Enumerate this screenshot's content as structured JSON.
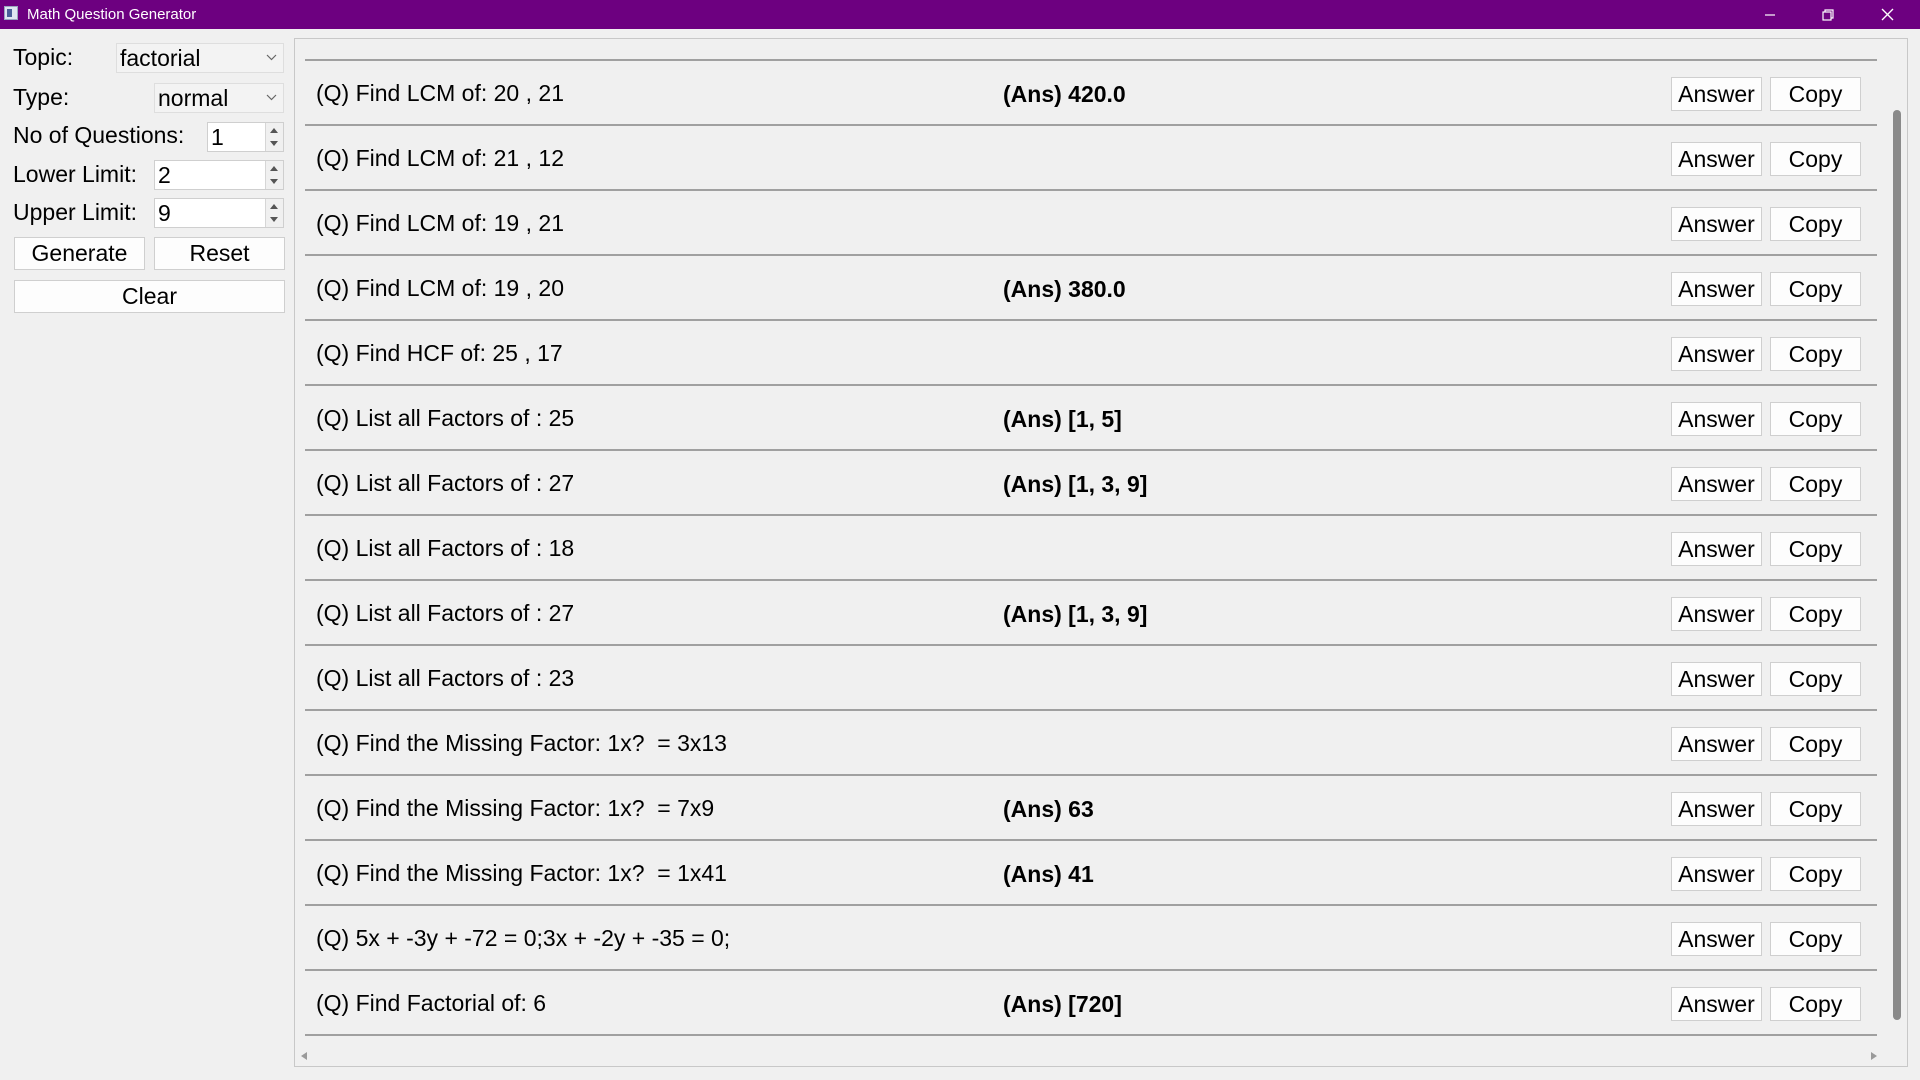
{
  "window": {
    "title": "Math Question Generator",
    "accent_color": "#6d0080",
    "controls": [
      "minimize-icon",
      "restore-icon",
      "close-icon"
    ]
  },
  "panel": {
    "topic_label": "Topic:",
    "topic_value": "factorial",
    "type_label": "Type:",
    "type_value": "normal",
    "count_label": "No of Questions:",
    "count_value": "1",
    "lower_label": "Lower Limit:",
    "lower_value": "2",
    "upper_label": "Upper Limit:",
    "upper_value": "9",
    "generate_label": "Generate",
    "reset_label": "Reset",
    "clear_label": "Clear"
  },
  "questions": [
    {
      "q": "(Q) Find LCM of: 20 , 21",
      "a": "(Ans) 420.0",
      "answer_label": "Answer",
      "copy_label": "Copy"
    },
    {
      "q": "(Q) Find LCM of: 21 , 12",
      "a": "",
      "answer_label": "Answer",
      "copy_label": "Copy"
    },
    {
      "q": "(Q) Find LCM of: 19 , 21",
      "a": "",
      "answer_label": "Answer",
      "copy_label": "Copy"
    },
    {
      "q": "(Q) Find LCM of: 19 , 20",
      "a": "(Ans) 380.0",
      "answer_label": "Answer",
      "copy_label": "Copy"
    },
    {
      "q": "(Q) Find HCF of: 25 , 17",
      "a": "",
      "answer_label": "Answer",
      "copy_label": "Copy"
    },
    {
      "q": "(Q) List all Factors of : 25",
      "a": "(Ans) [1, 5]",
      "answer_label": "Answer",
      "copy_label": "Copy"
    },
    {
      "q": "(Q) List all Factors of : 27",
      "a": "(Ans) [1, 3, 9]",
      "answer_label": "Answer",
      "copy_label": "Copy"
    },
    {
      "q": "(Q) List all Factors of : 18",
      "a": "",
      "answer_label": "Answer",
      "copy_label": "Copy"
    },
    {
      "q": "(Q) List all Factors of : 27",
      "a": "(Ans) [1, 3, 9]",
      "answer_label": "Answer",
      "copy_label": "Copy"
    },
    {
      "q": "(Q) List all Factors of : 23",
      "a": "",
      "answer_label": "Answer",
      "copy_label": "Copy"
    },
    {
      "q": "(Q) Find the Missing Factor: 1x?  = 3x13",
      "a": "",
      "answer_label": "Answer",
      "copy_label": "Copy"
    },
    {
      "q": "(Q) Find the Missing Factor: 1x?  = 7x9",
      "a": "(Ans) 63",
      "answer_label": "Answer",
      "copy_label": "Copy"
    },
    {
      "q": "(Q) Find the Missing Factor: 1x?  = 1x41",
      "a": "(Ans) 41",
      "answer_label": "Answer",
      "copy_label": "Copy"
    },
    {
      "q": "(Q) 5x + -3y + -72 = 0;3x + -2y + -35 = 0;",
      "a": "",
      "answer_label": "Answer",
      "copy_label": "Copy"
    },
    {
      "q": "(Q) Find Factorial of: 6",
      "a": "(Ans) [720]",
      "answer_label": "Answer",
      "copy_label": "Copy"
    }
  ]
}
